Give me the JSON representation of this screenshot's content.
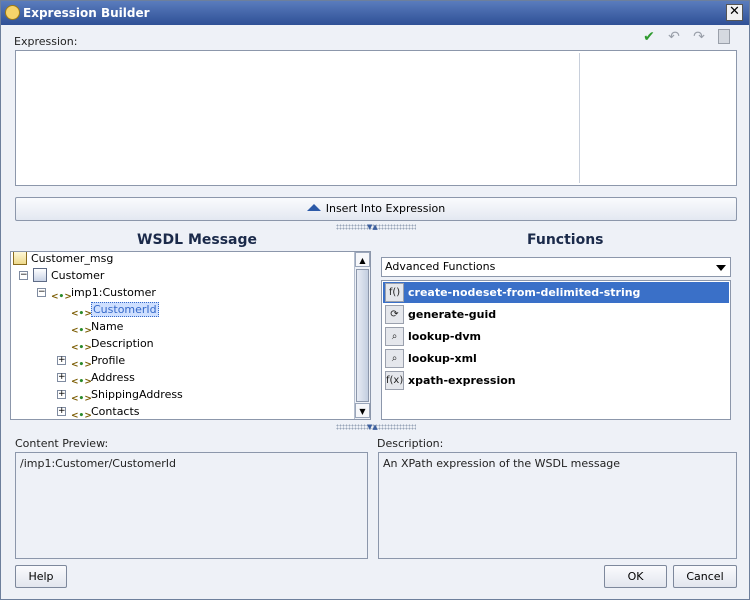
{
  "window": {
    "title": "Expression Builder"
  },
  "expression": {
    "label": "Expression:",
    "value": ""
  },
  "toolbar": {
    "icons": [
      "check-icon",
      "undo-icon",
      "redo-icon",
      "document-icon"
    ]
  },
  "insert_button": {
    "label": "Insert Into Expression"
  },
  "wsdl": {
    "title": "WSDL Message",
    "tree": [
      {
        "label": "Customer_msg",
        "icon": "document-icon"
      },
      {
        "label": "Customer",
        "icon": "message-icon"
      },
      {
        "label": "imp1:Customer",
        "icon": "element-icon"
      },
      {
        "label": "CustomerId",
        "icon": "element-icon",
        "selected": true
      },
      {
        "label": "Name",
        "icon": "element-icon"
      },
      {
        "label": "Description",
        "icon": "element-icon"
      },
      {
        "label": "Profile",
        "icon": "element-icon"
      },
      {
        "label": "Address",
        "icon": "element-icon"
      },
      {
        "label": "ShippingAddress",
        "icon": "element-icon"
      },
      {
        "label": "Contacts",
        "icon": "element-icon"
      }
    ]
  },
  "functions": {
    "title": "Functions",
    "category": "Advanced Functions",
    "items": [
      {
        "label": "create-nodeset-from-delimited-string",
        "icon_text": "f()",
        "selected": true
      },
      {
        "label": "generate-guid",
        "icon_text": "⟳"
      },
      {
        "label": "lookup-dvm",
        "icon_text": "⌕"
      },
      {
        "label": "lookup-xml",
        "icon_text": "⌕"
      },
      {
        "label": "xpath-expression",
        "icon_text": "f(x)"
      }
    ]
  },
  "content_preview": {
    "label": "Content Preview:",
    "value": "/imp1:Customer/CustomerId"
  },
  "description": {
    "label": "Description:",
    "value": "An XPath expression of the WSDL message"
  },
  "buttons": {
    "help": "Help",
    "ok": "OK",
    "cancel": "Cancel"
  }
}
